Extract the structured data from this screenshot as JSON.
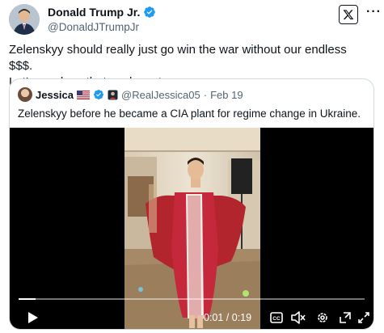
{
  "post": {
    "author": {
      "display_name": "Donald Trump Jr.",
      "handle": "@DonaldJTrumpJr",
      "verified_color": "#1d9bf0"
    },
    "text": "Zelenskyy should really just go win the war without our endless $$$.\nLet’s see how that works out.",
    "icons": [
      "x-logo-icon",
      "more-icon"
    ]
  },
  "quote": {
    "author": {
      "display_name": "Jessica",
      "handle": "@RealJessica05",
      "separator": "·",
      "date": "Feb 19"
    },
    "text": "Zelenskyy before he became a CIA plant for regime change in Ukraine.",
    "video": {
      "time": "0:01 / 0:19",
      "progress": 0.05,
      "controls": [
        "play-icon",
        "captions-icon",
        "mute-icon",
        "settings-icon",
        "pip-icon",
        "fullscreen-icon"
      ]
    }
  }
}
